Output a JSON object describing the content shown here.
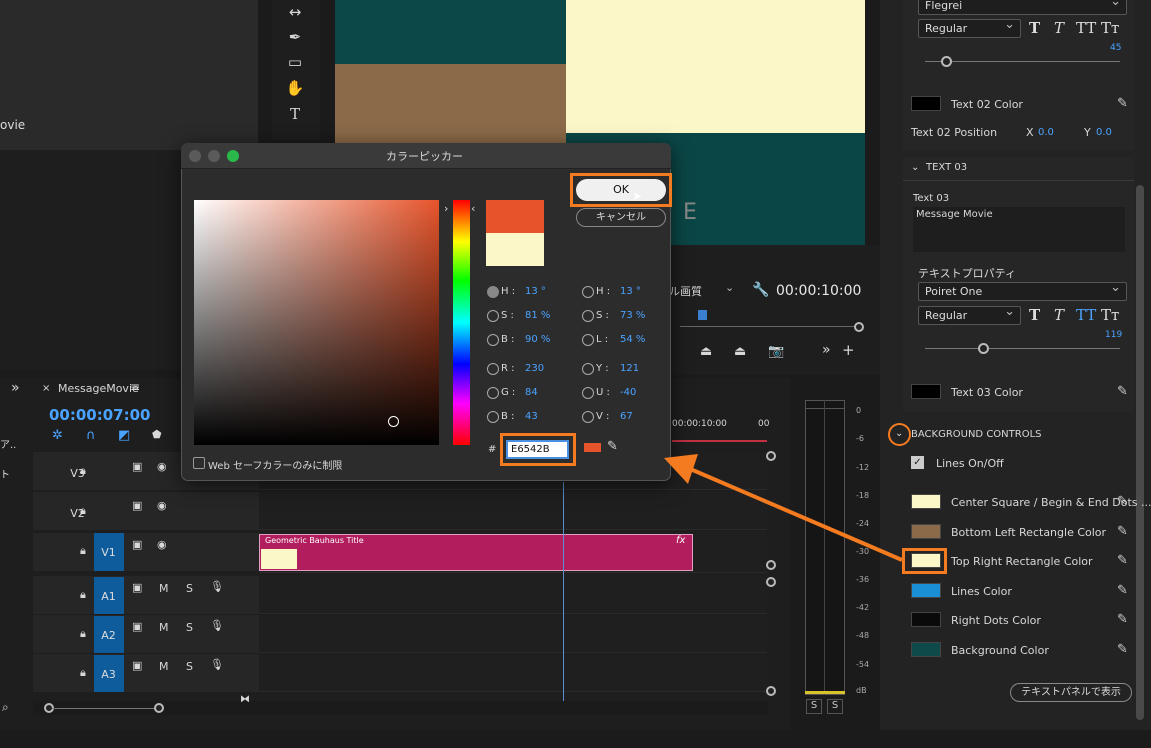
{
  "left_panel": {
    "partial_text": "ovie"
  },
  "timeline": {
    "tab_label": "MessageMovie",
    "timecode": "00:00:07:00",
    "ruler_time": "00:00:10:00",
    "ruler_time_short": "00",
    "tracks": [
      {
        "label": "V3",
        "col1": "",
        "col2": ""
      },
      {
        "label": "V2",
        "col1": "",
        "col2": ""
      },
      {
        "label": "V1",
        "col1": "",
        "col2": ""
      },
      {
        "label": "A1",
        "col1": "M",
        "col2": "S"
      },
      {
        "label": "A2",
        "col1": "M",
        "col2": "S"
      },
      {
        "label": "A3",
        "col1": "M",
        "col2": "S"
      }
    ],
    "clip_label": "Geometric Bauhaus Title",
    "clip_fx": "fx",
    "left_cut": [
      "ア..",
      "ト"
    ]
  },
  "program": {
    "quality": "ル画質",
    "timecode": "00:00:10:00",
    "marker": "E"
  },
  "meter": {
    "scale": [
      "0",
      "-6",
      "-12",
      "-18",
      "-24",
      "-30",
      "-36",
      "-42",
      "-48",
      "-54",
      "dB"
    ],
    "solo_left": "S",
    "solo_right": "S"
  },
  "dialog": {
    "title": "カラーピッカー",
    "ok": "OK",
    "cancel": "キャンセル",
    "hsb": [
      {
        "l": "H :",
        "v": "13 °"
      },
      {
        "l": "S :",
        "v": "81 %"
      },
      {
        "l": "B :",
        "v": "90 %"
      }
    ],
    "hsl": [
      {
        "l": "H :",
        "v": "13 °"
      },
      {
        "l": "S :",
        "v": "73 %"
      },
      {
        "l": "L :",
        "v": "54 %"
      }
    ],
    "rgb": [
      {
        "l": "R :",
        "v": "230"
      },
      {
        "l": "G :",
        "v": "84"
      },
      {
        "l": "B :",
        "v": "43"
      }
    ],
    "yuv": [
      {
        "l": "Y :",
        "v": "121"
      },
      {
        "l": "U :",
        "v": "-40"
      },
      {
        "l": "V :",
        "v": "67"
      }
    ],
    "hash": "#",
    "hex": "E6542B",
    "websafe": "Web セーフカラーのみに制限",
    "new_color": "#e6542b",
    "old_color": "#fbf7c8"
  },
  "right_panel": {
    "font_top": "Flegrei",
    "style_top": "Regular",
    "size_top": "45",
    "text02_color": "Text 02 Color",
    "text02_position": "Text 02 Position",
    "x_label": "X",
    "x_val": "0.0",
    "y_label": "Y",
    "y_val": "0.0",
    "text03_header": "TEXT 03",
    "text03_label": "Text 03",
    "text03_value": "Message Movie",
    "text_props": "テキストプロパティ",
    "font": "Poiret One",
    "style": "Regular",
    "size": "119",
    "text03_color": "Text 03 Color",
    "bg_header": "BACKGROUND CONTROLS",
    "lines_onoff": "Lines On/Off",
    "colors": [
      {
        "label": "Center Square / Begin & End Dots ...",
        "color": "#fbf7c8"
      },
      {
        "label": "Bottom Left Rectangle Color",
        "color": "#8a6a48"
      },
      {
        "label": "Top Right Rectangle Color",
        "color": "#fbf7c8"
      },
      {
        "label": "Lines Color",
        "color": "#1a8fd6"
      },
      {
        "label": "Right Dots Color",
        "color": "#0a0a0a"
      },
      {
        "label": "Background Color",
        "color": "#0f4a4b"
      }
    ],
    "show_in_panel": "テキストパネルで表示"
  },
  "accent_color": "#f47b20"
}
